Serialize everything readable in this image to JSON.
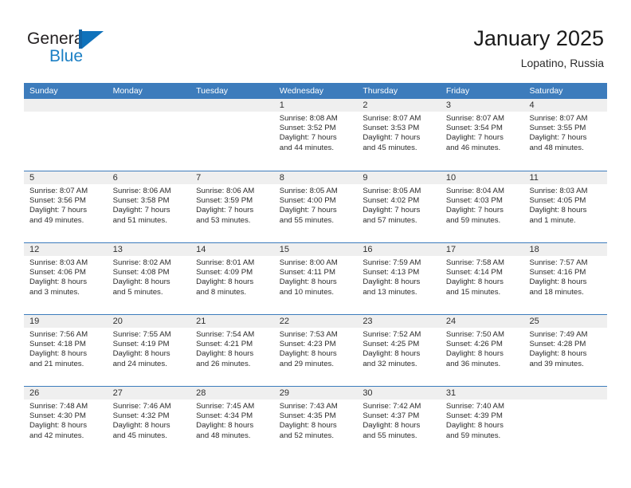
{
  "brand": {
    "logo_text_primary": "General",
    "logo_text_secondary": "Blue",
    "logo_icon": "triangle-flag-icon",
    "accent_color": "#3d7cbc",
    "logo_blue": "#1b7fc4"
  },
  "header": {
    "title": "January 2025",
    "subtitle": "Lopatino, Russia"
  },
  "calendar": {
    "weekdays": [
      "Sunday",
      "Monday",
      "Tuesday",
      "Wednesday",
      "Thursday",
      "Friday",
      "Saturday"
    ],
    "header_bg": "#3d7cbc",
    "daynum_band_bg": "#efefef",
    "weeks": [
      [
        {
          "day": "",
          "empty": true,
          "sunrise": "",
          "sunset": "",
          "daylight1": "",
          "daylight2": ""
        },
        {
          "day": "",
          "empty": true,
          "sunrise": "",
          "sunset": "",
          "daylight1": "",
          "daylight2": ""
        },
        {
          "day": "",
          "empty": true,
          "sunrise": "",
          "sunset": "",
          "daylight1": "",
          "daylight2": ""
        },
        {
          "day": "1",
          "empty": false,
          "sunrise": "Sunrise: 8:08 AM",
          "sunset": "Sunset: 3:52 PM",
          "daylight1": "Daylight: 7 hours",
          "daylight2": "and 44 minutes."
        },
        {
          "day": "2",
          "empty": false,
          "sunrise": "Sunrise: 8:07 AM",
          "sunset": "Sunset: 3:53 PM",
          "daylight1": "Daylight: 7 hours",
          "daylight2": "and 45 minutes."
        },
        {
          "day": "3",
          "empty": false,
          "sunrise": "Sunrise: 8:07 AM",
          "sunset": "Sunset: 3:54 PM",
          "daylight1": "Daylight: 7 hours",
          "daylight2": "and 46 minutes."
        },
        {
          "day": "4",
          "empty": false,
          "sunrise": "Sunrise: 8:07 AM",
          "sunset": "Sunset: 3:55 PM",
          "daylight1": "Daylight: 7 hours",
          "daylight2": "and 48 minutes."
        }
      ],
      [
        {
          "day": "5",
          "empty": false,
          "sunrise": "Sunrise: 8:07 AM",
          "sunset": "Sunset: 3:56 PM",
          "daylight1": "Daylight: 7 hours",
          "daylight2": "and 49 minutes."
        },
        {
          "day": "6",
          "empty": false,
          "sunrise": "Sunrise: 8:06 AM",
          "sunset": "Sunset: 3:58 PM",
          "daylight1": "Daylight: 7 hours",
          "daylight2": "and 51 minutes."
        },
        {
          "day": "7",
          "empty": false,
          "sunrise": "Sunrise: 8:06 AM",
          "sunset": "Sunset: 3:59 PM",
          "daylight1": "Daylight: 7 hours",
          "daylight2": "and 53 minutes."
        },
        {
          "day": "8",
          "empty": false,
          "sunrise": "Sunrise: 8:05 AM",
          "sunset": "Sunset: 4:00 PM",
          "daylight1": "Daylight: 7 hours",
          "daylight2": "and 55 minutes."
        },
        {
          "day": "9",
          "empty": false,
          "sunrise": "Sunrise: 8:05 AM",
          "sunset": "Sunset: 4:02 PM",
          "daylight1": "Daylight: 7 hours",
          "daylight2": "and 57 minutes."
        },
        {
          "day": "10",
          "empty": false,
          "sunrise": "Sunrise: 8:04 AM",
          "sunset": "Sunset: 4:03 PM",
          "daylight1": "Daylight: 7 hours",
          "daylight2": "and 59 minutes."
        },
        {
          "day": "11",
          "empty": false,
          "sunrise": "Sunrise: 8:03 AM",
          "sunset": "Sunset: 4:05 PM",
          "daylight1": "Daylight: 8 hours",
          "daylight2": "and 1 minute."
        }
      ],
      [
        {
          "day": "12",
          "empty": false,
          "sunrise": "Sunrise: 8:03 AM",
          "sunset": "Sunset: 4:06 PM",
          "daylight1": "Daylight: 8 hours",
          "daylight2": "and 3 minutes."
        },
        {
          "day": "13",
          "empty": false,
          "sunrise": "Sunrise: 8:02 AM",
          "sunset": "Sunset: 4:08 PM",
          "daylight1": "Daylight: 8 hours",
          "daylight2": "and 5 minutes."
        },
        {
          "day": "14",
          "empty": false,
          "sunrise": "Sunrise: 8:01 AM",
          "sunset": "Sunset: 4:09 PM",
          "daylight1": "Daylight: 8 hours",
          "daylight2": "and 8 minutes."
        },
        {
          "day": "15",
          "empty": false,
          "sunrise": "Sunrise: 8:00 AM",
          "sunset": "Sunset: 4:11 PM",
          "daylight1": "Daylight: 8 hours",
          "daylight2": "and 10 minutes."
        },
        {
          "day": "16",
          "empty": false,
          "sunrise": "Sunrise: 7:59 AM",
          "sunset": "Sunset: 4:13 PM",
          "daylight1": "Daylight: 8 hours",
          "daylight2": "and 13 minutes."
        },
        {
          "day": "17",
          "empty": false,
          "sunrise": "Sunrise: 7:58 AM",
          "sunset": "Sunset: 4:14 PM",
          "daylight1": "Daylight: 8 hours",
          "daylight2": "and 15 minutes."
        },
        {
          "day": "18",
          "empty": false,
          "sunrise": "Sunrise: 7:57 AM",
          "sunset": "Sunset: 4:16 PM",
          "daylight1": "Daylight: 8 hours",
          "daylight2": "and 18 minutes."
        }
      ],
      [
        {
          "day": "19",
          "empty": false,
          "sunrise": "Sunrise: 7:56 AM",
          "sunset": "Sunset: 4:18 PM",
          "daylight1": "Daylight: 8 hours",
          "daylight2": "and 21 minutes."
        },
        {
          "day": "20",
          "empty": false,
          "sunrise": "Sunrise: 7:55 AM",
          "sunset": "Sunset: 4:19 PM",
          "daylight1": "Daylight: 8 hours",
          "daylight2": "and 24 minutes."
        },
        {
          "day": "21",
          "empty": false,
          "sunrise": "Sunrise: 7:54 AM",
          "sunset": "Sunset: 4:21 PM",
          "daylight1": "Daylight: 8 hours",
          "daylight2": "and 26 minutes."
        },
        {
          "day": "22",
          "empty": false,
          "sunrise": "Sunrise: 7:53 AM",
          "sunset": "Sunset: 4:23 PM",
          "daylight1": "Daylight: 8 hours",
          "daylight2": "and 29 minutes."
        },
        {
          "day": "23",
          "empty": false,
          "sunrise": "Sunrise: 7:52 AM",
          "sunset": "Sunset: 4:25 PM",
          "daylight1": "Daylight: 8 hours",
          "daylight2": "and 32 minutes."
        },
        {
          "day": "24",
          "empty": false,
          "sunrise": "Sunrise: 7:50 AM",
          "sunset": "Sunset: 4:26 PM",
          "daylight1": "Daylight: 8 hours",
          "daylight2": "and 36 minutes."
        },
        {
          "day": "25",
          "empty": false,
          "sunrise": "Sunrise: 7:49 AM",
          "sunset": "Sunset: 4:28 PM",
          "daylight1": "Daylight: 8 hours",
          "daylight2": "and 39 minutes."
        }
      ],
      [
        {
          "day": "26",
          "empty": false,
          "sunrise": "Sunrise: 7:48 AM",
          "sunset": "Sunset: 4:30 PM",
          "daylight1": "Daylight: 8 hours",
          "daylight2": "and 42 minutes."
        },
        {
          "day": "27",
          "empty": false,
          "sunrise": "Sunrise: 7:46 AM",
          "sunset": "Sunset: 4:32 PM",
          "daylight1": "Daylight: 8 hours",
          "daylight2": "and 45 minutes."
        },
        {
          "day": "28",
          "empty": false,
          "sunrise": "Sunrise: 7:45 AM",
          "sunset": "Sunset: 4:34 PM",
          "daylight1": "Daylight: 8 hours",
          "daylight2": "and 48 minutes."
        },
        {
          "day": "29",
          "empty": false,
          "sunrise": "Sunrise: 7:43 AM",
          "sunset": "Sunset: 4:35 PM",
          "daylight1": "Daylight: 8 hours",
          "daylight2": "and 52 minutes."
        },
        {
          "day": "30",
          "empty": false,
          "sunrise": "Sunrise: 7:42 AM",
          "sunset": "Sunset: 4:37 PM",
          "daylight1": "Daylight: 8 hours",
          "daylight2": "and 55 minutes."
        },
        {
          "day": "31",
          "empty": false,
          "sunrise": "Sunrise: 7:40 AM",
          "sunset": "Sunset: 4:39 PM",
          "daylight1": "Daylight: 8 hours",
          "daylight2": "and 59 minutes."
        },
        {
          "day": "",
          "empty": true,
          "sunrise": "",
          "sunset": "",
          "daylight1": "",
          "daylight2": ""
        }
      ]
    ]
  }
}
